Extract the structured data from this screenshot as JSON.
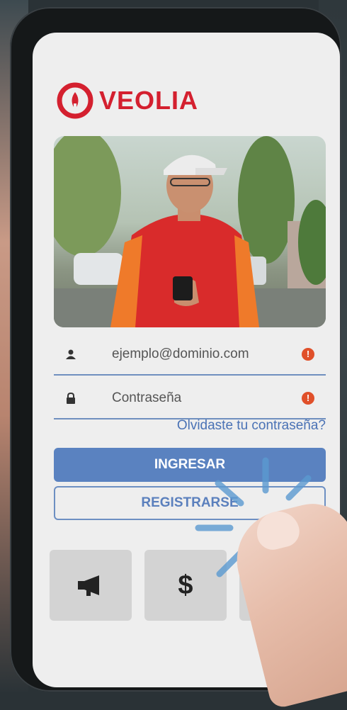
{
  "brand": {
    "name": "VEOLIA",
    "color": "#d4202f"
  },
  "login": {
    "email_value": "ejemplo@dominio.com",
    "password_placeholder": "Contraseña",
    "forgot_link": "Olvidaste tu contraseña?",
    "login_button": "INGRESAR",
    "register_button": "REGISTRARSE",
    "alert_glyph": "!"
  },
  "quick_actions": [
    {
      "icon": "megaphone-icon"
    },
    {
      "icon": "dollar-icon",
      "glyph": "$"
    },
    {
      "icon": "chat-icon"
    }
  ],
  "colors": {
    "accent": "#5a82c0",
    "field_underline": "#6f8fbf",
    "alert": "#e0502a"
  }
}
